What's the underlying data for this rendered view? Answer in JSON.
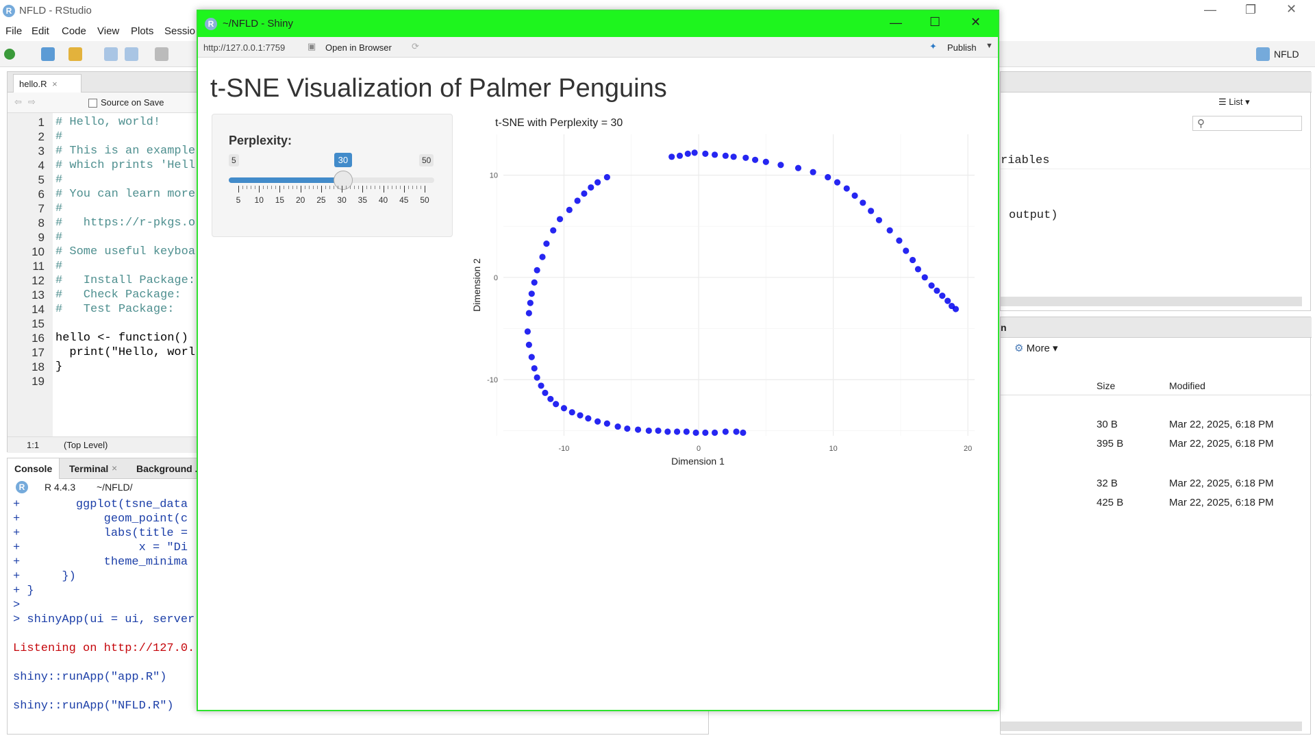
{
  "rstudio": {
    "window_title": "NFLD - RStudio",
    "menu": [
      "File",
      "Edit",
      "Code",
      "View",
      "Plots",
      "Sessio"
    ],
    "project_label": "NFLD"
  },
  "source": {
    "tab_label": "hello.R",
    "source_on_save_label": "Source on Save",
    "lines": [
      {
        "n": "1",
        "text": "# Hello, world!",
        "kind": "cmt"
      },
      {
        "n": "2",
        "text": "#",
        "kind": "cmt"
      },
      {
        "n": "3",
        "text": "# This is an example",
        "kind": "cmt"
      },
      {
        "n": "4",
        "text": "# which prints 'Hell",
        "kind": "cmt"
      },
      {
        "n": "5",
        "text": "#",
        "kind": "cmt"
      },
      {
        "n": "6",
        "text": "# You can learn more",
        "kind": "cmt"
      },
      {
        "n": "7",
        "text": "#",
        "kind": "cmt"
      },
      {
        "n": "8",
        "text": "#   https://r-pkgs.o",
        "kind": "cmt"
      },
      {
        "n": "9",
        "text": "#",
        "kind": "cmt"
      },
      {
        "n": "10",
        "text": "# Some useful keyboa",
        "kind": "cmt"
      },
      {
        "n": "11",
        "text": "#",
        "kind": "cmt"
      },
      {
        "n": "12",
        "text": "#   Install Package:",
        "kind": "cmt"
      },
      {
        "n": "13",
        "text": "#   Check Package:",
        "kind": "cmt"
      },
      {
        "n": "14",
        "text": "#   Test Package:",
        "kind": "cmt"
      },
      {
        "n": "15",
        "text": "",
        "kind": "plain"
      },
      {
        "n": "16",
        "text": "hello <- function()",
        "kind": "plain"
      },
      {
        "n": "17",
        "text": "  print(\"Hello, worl",
        "kind": "plain"
      },
      {
        "n": "18",
        "text": "}",
        "kind": "plain"
      },
      {
        "n": "19",
        "text": "",
        "kind": "plain"
      }
    ],
    "cursor_pos": "1:1",
    "scope": "(Top Level)"
  },
  "console": {
    "tabs": [
      "Console",
      "Terminal",
      "Background ."
    ],
    "r_version": "R 4.4.3",
    "path": "~/NFLD/",
    "lines": [
      {
        "text": "+        ggplot(tsne_data",
        "kind": "code"
      },
      {
        "text": "+            geom_point(c",
        "kind": "code"
      },
      {
        "text": "+            labs(title =",
        "kind": "code"
      },
      {
        "text": "+                 x = \"Di",
        "kind": "code"
      },
      {
        "text": "+            theme_minima",
        "kind": "code"
      },
      {
        "text": "+      })",
        "kind": "code"
      },
      {
        "text": "+ }",
        "kind": "code"
      },
      {
        "text": ">",
        "kind": "code"
      },
      {
        "text": "> shinyApp(ui = ui, server",
        "kind": "code"
      },
      {
        "text": "",
        "kind": "code"
      },
      {
        "text": "Listening on http://127.0.",
        "kind": "red"
      },
      {
        "text": "",
        "kind": "code"
      },
      {
        "text": "shiny::runApp(\"app.R\")",
        "kind": "code"
      },
      {
        "text": "",
        "kind": "code"
      },
      {
        "text": "shiny::runApp(\"NFLD.R\")",
        "kind": "code"
      }
    ]
  },
  "environment": {
    "list_label": "List",
    "row1": "riables",
    "row2": "output)"
  },
  "files": {
    "more_label": "More",
    "col_size": "Size",
    "col_modified": "Modified",
    "tab_fragment": "n",
    "rows": [
      {
        "size": "30 B",
        "modified": "Mar 22, 2025, 6:18 PM"
      },
      {
        "size": "395 B",
        "modified": "Mar 22, 2025, 6:18 PM"
      },
      {
        "size": "32 B",
        "modified": "Mar 22, 2025, 6:18 PM"
      },
      {
        "size": "425 B",
        "modified": "Mar 22, 2025, 6:18 PM"
      }
    ]
  },
  "shiny": {
    "window_title": "~/NFLD - Shiny",
    "url": "http://127.0.0.1:7759",
    "open_in_browser": "Open in Browser",
    "publish": "Publish",
    "app_title": "t-SNE Visualization of Palmer Penguins",
    "slider": {
      "label": "Perplexity:",
      "min": 5,
      "max": 50,
      "value": 30,
      "min_label": "5",
      "max_label": "50",
      "value_label": "30",
      "ticks": [
        "5",
        "10",
        "15",
        "20",
        "25",
        "30",
        "35",
        "40",
        "45",
        "50"
      ]
    }
  },
  "chart_data": {
    "type": "scatter",
    "title": "t-SNE with Perplexity = 30",
    "xlabel": "Dimension 1",
    "ylabel": "Dimension 2",
    "xlim": [
      -14.5,
      20.5
    ],
    "ylim": [
      -15.5,
      14
    ],
    "xticks": [
      "-10",
      "0",
      "10",
      "20"
    ],
    "yticks": [
      "-10",
      "0",
      "10"
    ],
    "grid": true,
    "point_color": "#0000ee",
    "x": [
      -2.0,
      -1.4,
      -0.8,
      -0.3,
      0.5,
      1.2,
      2.0,
      2.6,
      3.5,
      4.2,
      5.0,
      6.1,
      7.4,
      8.5,
      9.6,
      10.3,
      11.0,
      11.6,
      12.2,
      12.8,
      13.4,
      14.2,
      14.9,
      15.4,
      15.9,
      16.3,
      16.8,
      17.3,
      17.7,
      18.1,
      18.5,
      18.8,
      19.1,
      -6.8,
      -7.5,
      -8.0,
      -8.5,
      -9.0,
      -9.6,
      -10.3,
      -10.8,
      -11.3,
      -11.6,
      -12.0,
      -12.2,
      -12.4,
      -12.5,
      -12.6,
      -12.7,
      -12.6,
      -12.4,
      -12.2,
      -12.0,
      -11.7,
      -11.4,
      -11.0,
      -10.6,
      -10.0,
      -9.4,
      -8.8,
      -8.2,
      -7.5,
      -6.8,
      -6.0,
      -5.3,
      -4.5,
      -3.7,
      -3.0,
      -2.3,
      -1.6,
      -0.9,
      -0.2,
      0.5,
      1.2,
      2.0,
      2.8,
      3.3
    ],
    "y": [
      11.8,
      11.9,
      12.1,
      12.2,
      12.1,
      12.0,
      11.9,
      11.8,
      11.7,
      11.5,
      11.3,
      11.0,
      10.7,
      10.3,
      9.8,
      9.3,
      8.7,
      8.0,
      7.3,
      6.5,
      5.6,
      4.6,
      3.6,
      2.6,
      1.7,
      0.8,
      0.0,
      -0.8,
      -1.3,
      -1.8,
      -2.3,
      -2.8,
      -3.1,
      9.8,
      9.3,
      8.8,
      8.2,
      7.5,
      6.6,
      5.7,
      4.6,
      3.3,
      2.0,
      0.7,
      -0.5,
      -1.6,
      -2.5,
      -3.5,
      -5.3,
      -6.6,
      -7.8,
      -8.9,
      -9.8,
      -10.6,
      -11.3,
      -11.9,
      -12.4,
      -12.8,
      -13.2,
      -13.5,
      -13.8,
      -14.1,
      -14.3,
      -14.6,
      -14.8,
      -14.9,
      -15.0,
      -15.0,
      -15.1,
      -15.1,
      -15.1,
      -15.2,
      -15.2,
      -15.2,
      -15.1,
      -15.1,
      -15.2
    ]
  }
}
